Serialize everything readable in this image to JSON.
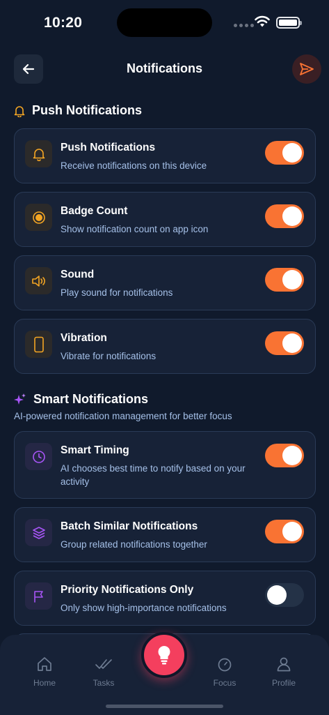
{
  "status": {
    "time": "10:20"
  },
  "header": {
    "title": "Notifications"
  },
  "push_section": {
    "title": "Push Notifications",
    "items": [
      {
        "title": "Push Notifications",
        "desc": "Receive notifications on this device",
        "icon": "bell-icon",
        "enabled": true
      },
      {
        "title": "Badge Count",
        "desc": "Show notification count on app icon",
        "icon": "badge-dot-icon",
        "enabled": true
      },
      {
        "title": "Sound",
        "desc": "Play sound for notifications",
        "icon": "speaker-icon",
        "enabled": true
      },
      {
        "title": "Vibration",
        "desc": "Vibrate for notifications",
        "icon": "phone-icon",
        "enabled": true
      }
    ]
  },
  "smart_section": {
    "title": "Smart Notifications",
    "subtitle": "AI-powered notification management for better focus",
    "items": [
      {
        "title": "Smart Timing",
        "desc": "AI chooses best time to notify based on your activity",
        "icon": "clock-icon",
        "enabled": true
      },
      {
        "title": "Batch Similar Notifications",
        "desc": "Group related notifications together",
        "icon": "layers-icon",
        "enabled": true
      },
      {
        "title": "Priority Notifications Only",
        "desc": "Only show high-importance notifications",
        "icon": "flag-icon",
        "enabled": false
      }
    ]
  },
  "tabs": {
    "home": "Home",
    "tasks": "Tasks",
    "focus": "Focus",
    "profile": "Profile"
  },
  "colors": {
    "background": "#101a2c",
    "card": "#172237",
    "accent": "#f97333",
    "fab": "#f43f5e",
    "muted_text": "#a5c0e8"
  }
}
